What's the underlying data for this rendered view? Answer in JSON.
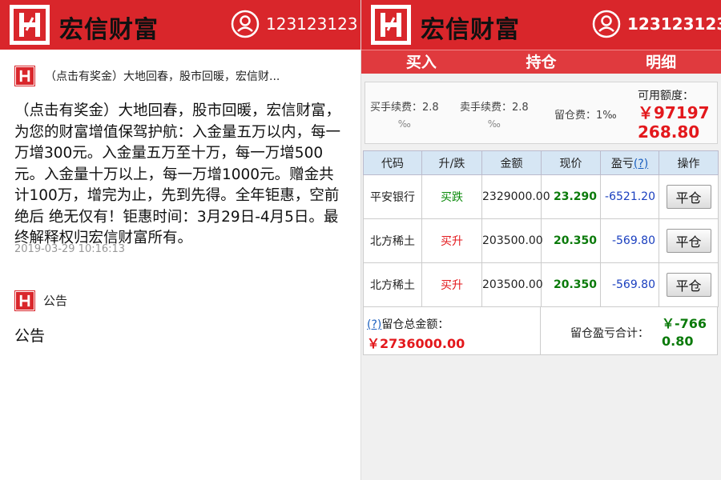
{
  "brand": "宏信财富",
  "account": "123123123",
  "left": {
    "message": {
      "title": "（点击有奖金）大地回春，股市回暖，宏信财...",
      "body": "（点击有奖金）大地回春，股市回暖，宏信财富，为您的财富增值保驾护航：入金量五万以内，每一万增300元。入金量五万至十万，每一万增500元。入金量十万以上，每一万增1000元。赠金共计100万，增完为止，先到先得。全年钜惠，空前绝后 绝无仅有！钜惠时间：3月29日-4月5日。最终解释权归宏信财富所有。",
      "time": "2019-03-29 10:16:13"
    },
    "notice": {
      "title": "公告",
      "body": "公告"
    }
  },
  "right": {
    "tabs": [
      "买入",
      "持仓",
      "明细"
    ],
    "fees": {
      "buy_label": "买手续费：2.8",
      "buy_unit": "‰",
      "sell_label": "卖手续费：2.8",
      "sell_unit": "‰",
      "hold_label": "留仓费：1‰",
      "avail_label": "可用额度：",
      "avail_value": "￥97197268.80"
    },
    "table": {
      "headers": [
        "代码",
        "升/跌",
        "金额",
        "现价",
        "盈亏",
        "操作"
      ],
      "help": "(?)",
      "rows": [
        {
          "name": "平安银行",
          "dir": "买跌",
          "amount": "2329000.00",
          "price": "23.290",
          "pl": "-6521.20",
          "action": "平仓"
        },
        {
          "name": "北方稀土",
          "dir": "买升",
          "amount": "203500.00",
          "price": "20.350",
          "pl": "-569.80",
          "action": "平仓"
        },
        {
          "name": "北方稀土",
          "dir": "买升",
          "amount": "203500.00",
          "price": "20.350",
          "pl": "-569.80",
          "action": "平仓"
        }
      ]
    },
    "summary": {
      "help": "(?)",
      "total_label": "留仓总金额：",
      "total_value": "￥2736000.00",
      "pl_label": "留仓盈亏合计：",
      "pl_value": "￥-7660.80"
    }
  },
  "colors": {
    "brand_red": "#d9262b",
    "gain": "#0a8a0a",
    "loss": "#e3181c",
    "link": "#1a3fbf"
  }
}
